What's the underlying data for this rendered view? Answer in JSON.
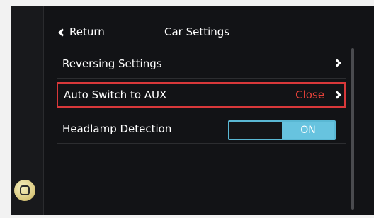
{
  "header": {
    "back_label": "Return",
    "title": "Car Settings"
  },
  "settings": {
    "reversing": {
      "label": "Reversing Settings"
    },
    "aux": {
      "label": "Auto Switch to AUX",
      "value": "Close"
    },
    "headlamp": {
      "label": "Headlamp Detection",
      "toggle_label": "ON",
      "state": "on"
    }
  },
  "colors": {
    "accent": "#67c3df",
    "highlight": "#d8383a",
    "value_text": "#e8423a",
    "background": "#121316"
  },
  "icons": {
    "back": "chevron-left-icon",
    "row_next": "chevron-right-icon",
    "home": "home-button-icon"
  }
}
